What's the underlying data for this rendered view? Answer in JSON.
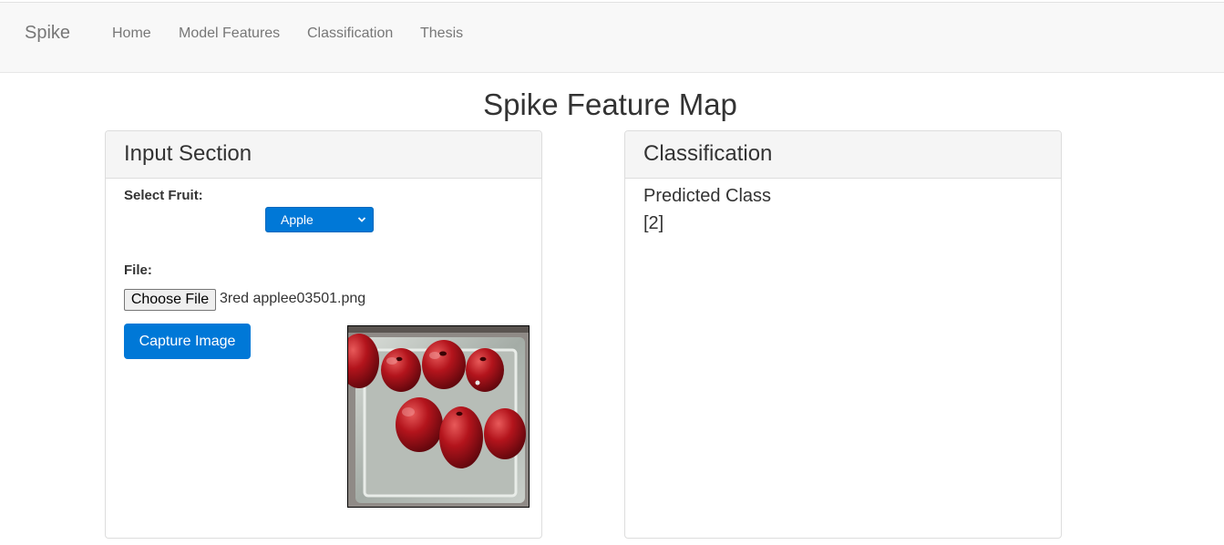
{
  "navbar": {
    "brand": "Spike",
    "links": [
      "Home",
      "Model Features",
      "Classification",
      "Thesis"
    ]
  },
  "page": {
    "title": "Spike Feature Map"
  },
  "input_section": {
    "heading": "Input Section",
    "select_label": "Select Fruit:",
    "selected_fruit": "Apple",
    "file_label": "File:",
    "choose_file_label": "Choose File",
    "file_name": "3red applee03501.png",
    "capture_button": "Capture Image",
    "preview_icon": "apple-tray-photo"
  },
  "classification": {
    "heading": "Classification",
    "predicted_label": "Predicted Class",
    "predicted_value": "[2]"
  },
  "colors": {
    "primary": "#0078d7",
    "navbar_bg": "#f8f8f8",
    "panel_heading_bg": "#f5f5f5",
    "text": "#333333",
    "nav_text": "#777777"
  }
}
